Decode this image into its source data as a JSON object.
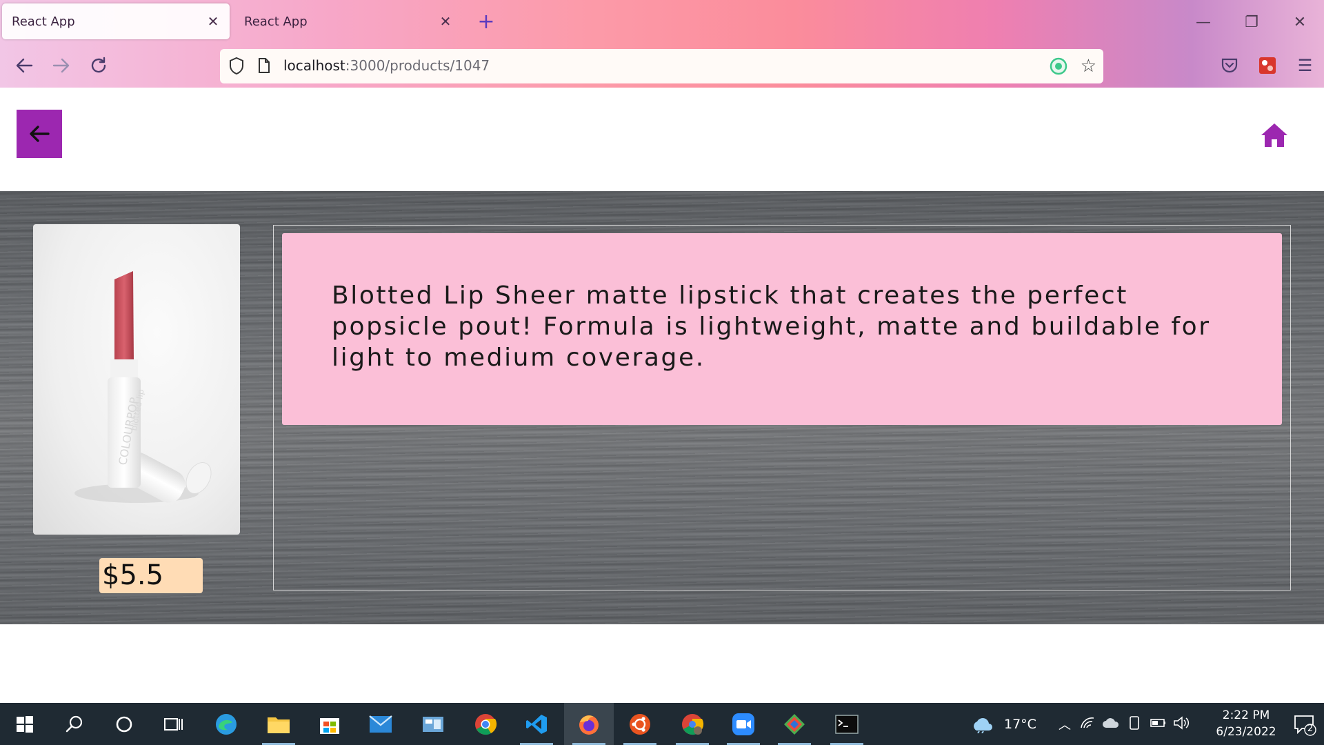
{
  "browser": {
    "tabs": [
      {
        "title": "React App"
      },
      {
        "title": "React App"
      }
    ],
    "url_host": "localhost",
    "url_rest": ":3000/products/1047"
  },
  "product": {
    "description": "Blotted Lip Sheer matte lipstick that creates the perfect popsicle pout! Formula is lightweight, matte and buildable for light to medium coverage.",
    "price": "$5.5",
    "image_text": "COLOURPOP",
    "image_subtext": "blotted lip"
  },
  "taskbar": {
    "temperature": "17°C",
    "time": "2:22 PM",
    "date": "6/23/2022",
    "notification_count": "2"
  },
  "colors": {
    "back_button": "#9c27b0",
    "home_icon": "#9c27b0",
    "description_card": "#fbbfd7",
    "price_tag": "#ffdcb5"
  }
}
